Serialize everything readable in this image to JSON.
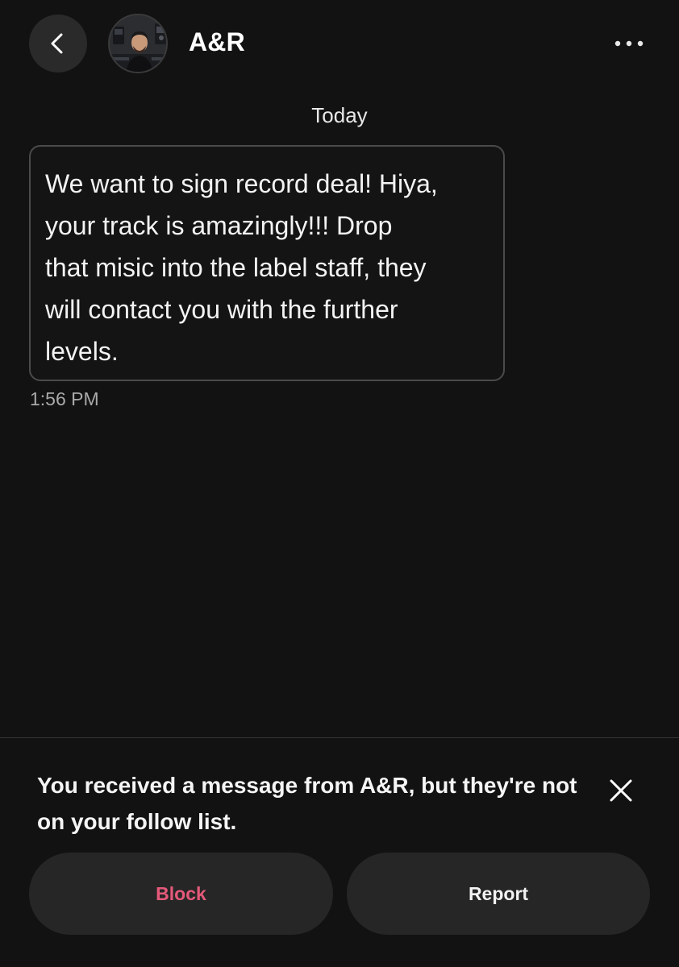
{
  "header": {
    "contact_name": "A&R",
    "back_icon": "chevron-left-icon",
    "more_icon": "more-horizontal-icon"
  },
  "thread": {
    "date_separator": "Today",
    "messages": [
      {
        "text": "We want to sign record deal! Hiya,\nyour track is amazingly!!! Drop\nthat misic into the label staff, they\nwill contact you with the further\nlevels.",
        "time": "1:56 PM"
      }
    ]
  },
  "request_panel": {
    "notice": "You received a message from A&R, but they're not on your follow list.",
    "block_label": "Block",
    "report_label": "Report",
    "close_icon": "close-icon"
  },
  "colors": {
    "background": "#121212",
    "block_accent": "#e5597a",
    "button_bg": "#262626"
  }
}
